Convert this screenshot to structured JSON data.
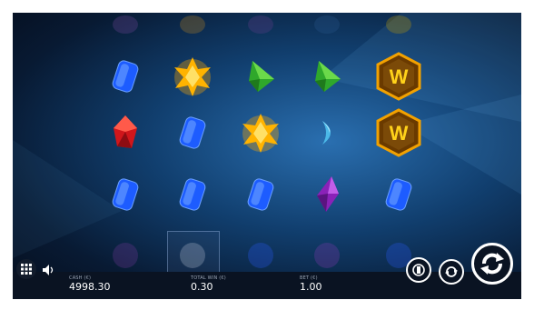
{
  "colors": {
    "accent": "#f2c300",
    "bar": "#0a1322"
  },
  "stats": [
    {
      "label": "CASH (€)",
      "value": "4998.30"
    },
    {
      "label": "TOTAL WIN (€)",
      "value": "0.30"
    },
    {
      "label": "BET (€)",
      "value": "1.00"
    }
  ],
  "wild_text": "W",
  "grid": [
    [
      "blue-gem",
      "yellow-star-gem",
      "green-gem",
      "green-gem",
      "wild-symbol"
    ],
    [
      "red-gem",
      "blue-gem",
      "yellow-star-gem",
      "cyan-gem",
      "wild-symbol"
    ],
    [
      "blue-gem",
      "blue-gem",
      "blue-gem",
      "purple-gem",
      "blue-gem"
    ]
  ],
  "icons": {
    "menu": "menu-grid-icon",
    "sound": "speaker-icon",
    "autoplay": "autoplay-icon",
    "turbo": "turbo-icon",
    "spin": "spin-icon"
  }
}
